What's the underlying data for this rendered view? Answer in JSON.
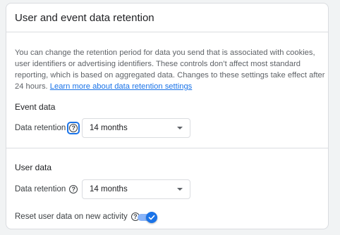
{
  "card": {
    "title": "User and event data retention"
  },
  "description": {
    "text": "You can change the retention period for data you send that is associated with cookies, user identifiers or advertising identifiers. These controls don’t affect most standard reporting, which is based on aggregated data. Changes to these settings take effect after 24 hours. ",
    "link": "Learn more about data retention settings"
  },
  "event_data": {
    "title": "Event data",
    "retention_label": "Data retention",
    "retention_value": "14 months"
  },
  "user_data": {
    "title": "User data",
    "retention_label": "Data retention",
    "retention_value": "14 months",
    "reset_label": "Reset user data on new activity",
    "reset_enabled": true
  },
  "colors": {
    "accent": "#1a73e8",
    "toggle_track": "#8ab4f8"
  }
}
